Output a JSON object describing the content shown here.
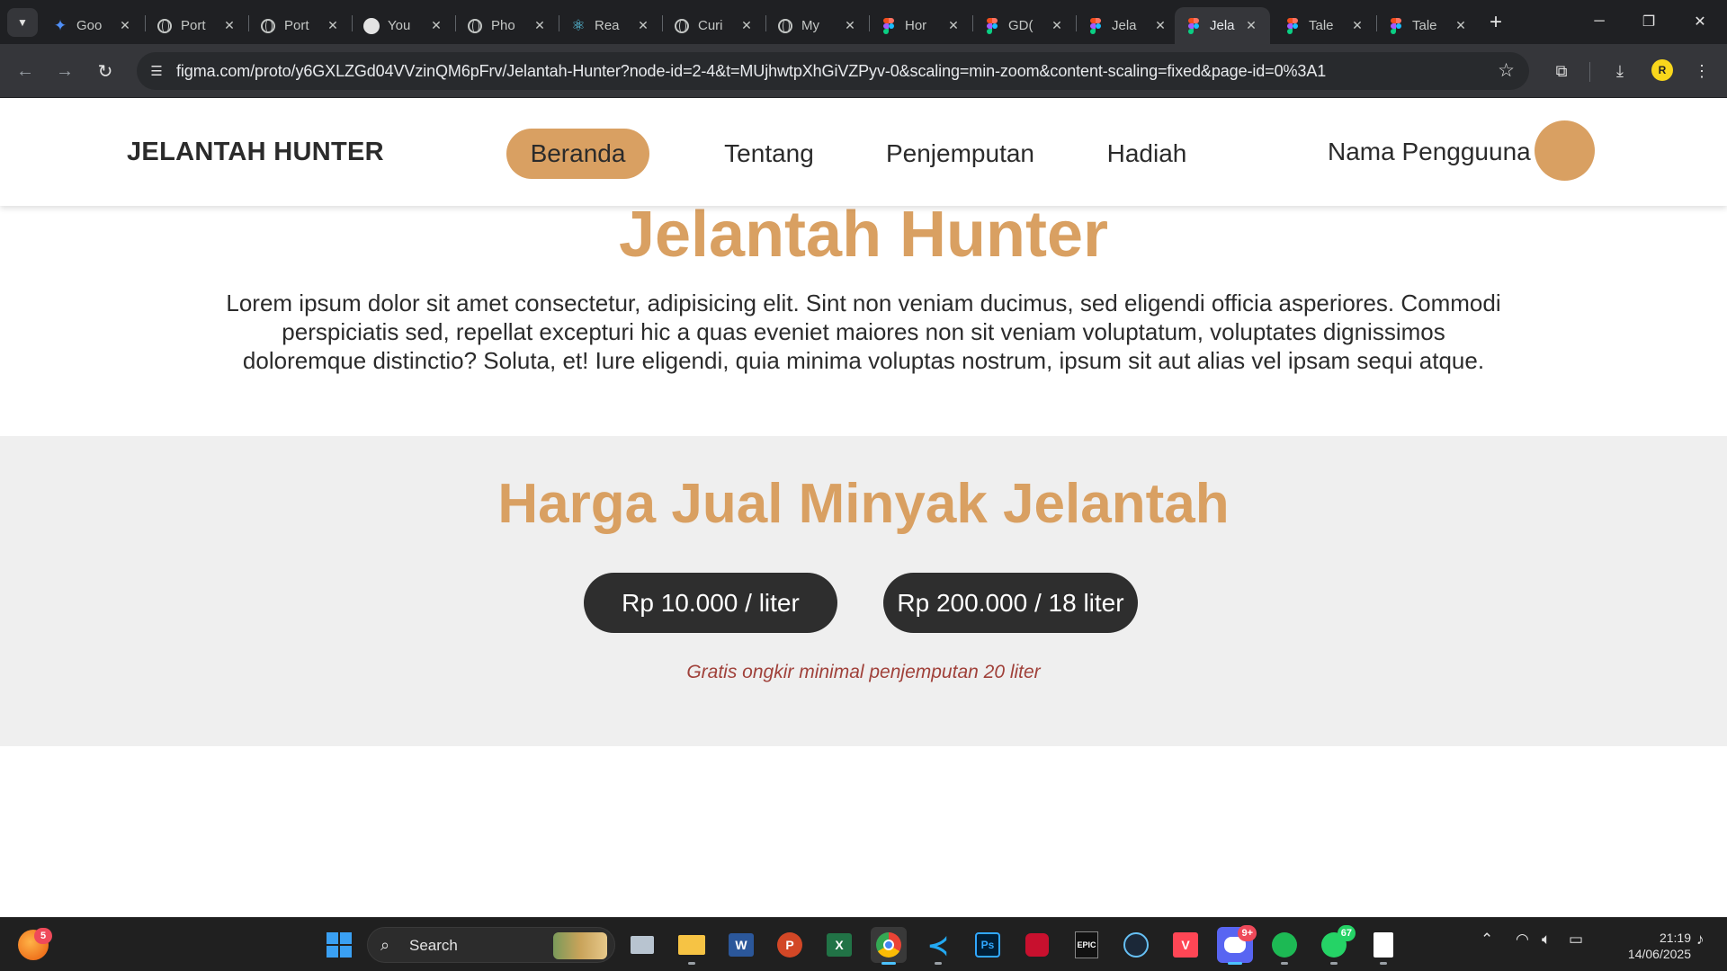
{
  "browser": {
    "tabs": [
      {
        "label": "Goo",
        "icon": "sparkle-icon"
      },
      {
        "label": "Port",
        "icon": "globe-icon"
      },
      {
        "label": "Port",
        "icon": "globe-icon"
      },
      {
        "label": "You",
        "icon": "github-icon"
      },
      {
        "label": "Pho",
        "icon": "globe-icon"
      },
      {
        "label": "Rea",
        "icon": "react-icon"
      },
      {
        "label": "Curi",
        "icon": "globe-icon"
      },
      {
        "label": "My",
        "icon": "globe-icon"
      },
      {
        "label": "Hor",
        "icon": "figma-icon"
      },
      {
        "label": "GD(",
        "icon": "figma-icon"
      },
      {
        "label": "Jela",
        "icon": "figma-icon"
      },
      {
        "label": "Jela",
        "icon": "figma-icon",
        "active": true
      },
      {
        "label": "Tale",
        "icon": "figma-icon"
      },
      {
        "label": "Tale",
        "icon": "figma-icon"
      }
    ],
    "url": "figma.com/proto/y6GXLZGd04VVzinQM6pFrv/Jelantah-Hunter?node-id=2-4&t=MUjhwtpXhGiVZPyv-0&scaling=min-zoom&content-scaling=fixed&page-id=0%3A1",
    "profile_initial": "R"
  },
  "site": {
    "brand": "JELANTAH HUNTER",
    "nav": [
      {
        "label": "Beranda",
        "active": true
      },
      {
        "label": "Tentang"
      },
      {
        "label": "Penjemputan"
      },
      {
        "label": "Hadiah"
      }
    ],
    "username": "Nama Pengguuna",
    "hero": {
      "title": "Jelantah Hunter",
      "text": "Lorem ipsum dolor sit amet consectetur, adipisicing elit. Sint non veniam ducimus, sed eligendi officia asperiores. Commodi perspiciatis sed, repellat excepturi hic a quas eveniet maiores non sit veniam voluptatum, voluptates dignissimos doloremque distinctio? Soluta, et! Iure eligendi, quia minima voluptas nostrum, ipsum sit aut alias vel ipsam sequi atque."
    },
    "price": {
      "title": "Harga Jual Minyak Jelantah",
      "options": [
        "Rp 10.000 / liter",
        "Rp 200.000 / 18 liter"
      ],
      "note": "Gratis ongkir minimal penjemputan 20 liter"
    },
    "colors": {
      "accent": "#d9a062",
      "dark": "#2e2e2e",
      "note": "#a0413a",
      "section_bg": "#efefef"
    }
  },
  "taskbar": {
    "search_label": "Search",
    "apps": [
      {
        "name": "firefox",
        "badge": "5"
      },
      {
        "name": "task-view"
      },
      {
        "name": "file-explorer"
      },
      {
        "name": "word",
        "glyph": "W"
      },
      {
        "name": "powerpoint",
        "glyph": "P"
      },
      {
        "name": "excel",
        "glyph": "X"
      },
      {
        "name": "chrome",
        "active": true
      },
      {
        "name": "vscode"
      },
      {
        "name": "photoshop",
        "glyph": "Ps"
      },
      {
        "name": "app-red"
      },
      {
        "name": "epic-games",
        "glyph": "EPIC"
      },
      {
        "name": "steam"
      },
      {
        "name": "valorant",
        "glyph": "V"
      },
      {
        "name": "discord",
        "badge": "9+"
      },
      {
        "name": "spotify"
      },
      {
        "name": "whatsapp",
        "badge": "67"
      },
      {
        "name": "notepad"
      }
    ],
    "time": "21:19",
    "date": "14/06/2025"
  }
}
